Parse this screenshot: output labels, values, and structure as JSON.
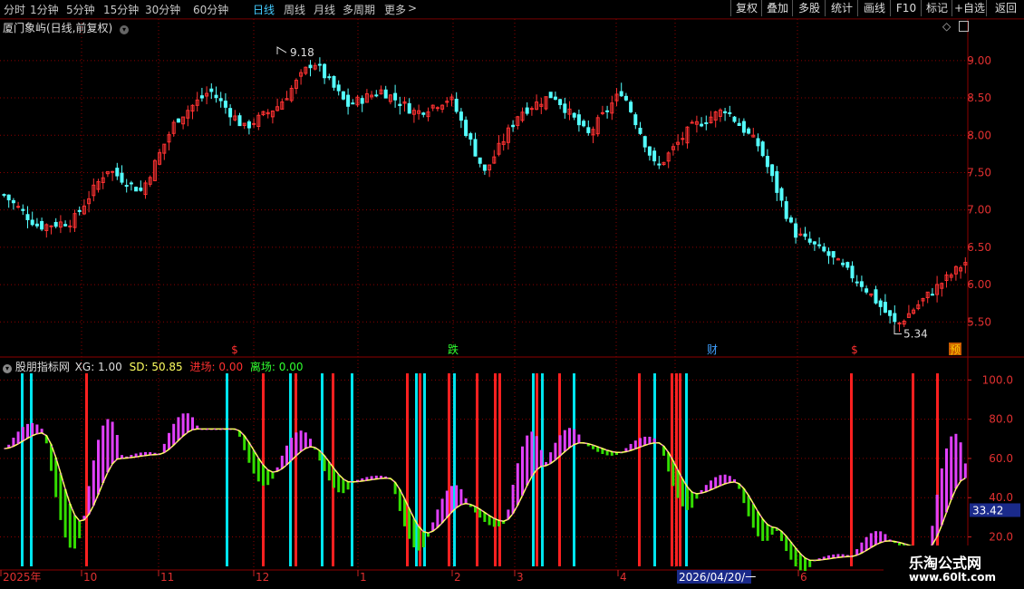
{
  "toolbar": {
    "periods": [
      "分时",
      "1分钟",
      "5分钟",
      "15分钟",
      "30分钟",
      "60分钟",
      "日线",
      "周线",
      "月线",
      "多周期",
      "更多"
    ],
    "active_period": "日线",
    "more_arrow": ">",
    "buttons": [
      "复权",
      "叠加",
      "多股",
      "统计",
      "画线",
      "F10",
      "标记",
      "+自选",
      "返回"
    ]
  },
  "main_panel": {
    "title": "厦门象屿(日线,前复权)",
    "high_marker": "9.18",
    "low_marker": "5.34",
    "event_markers": [
      {
        "text": "$",
        "color": "#ff3030"
      },
      {
        "text": "跌",
        "color": "#30ff30"
      },
      {
        "text": "财",
        "color": "#40a0ff"
      },
      {
        "text": "$",
        "color": "#ff3030"
      },
      {
        "text": "预",
        "color": "#ffcc00"
      }
    ]
  },
  "indicator_panel": {
    "name": "股朋指标网",
    "xg_label": "XG: 1.00",
    "sd_label": "SD: 50.85",
    "entry_label": "进场: 0.00",
    "exit_label": "离场: 0.00",
    "current_value_tag": "33.42"
  },
  "time_axis": {
    "labels": [
      "2025年",
      "10",
      "11",
      "12",
      "1",
      "2",
      "3",
      "4",
      "2026/04/20/一",
      "6"
    ]
  },
  "watermark": {
    "title": "乐淘公式网",
    "url": "www.60lt.com"
  },
  "colors": {
    "up": "#ff3232",
    "down": "#54ffff",
    "grid": "#8b0000",
    "bar_up": "#e040fb",
    "bar_down": "#33dd00",
    "signal_red": "#ff2020",
    "signal_cyan": "#00e5ee",
    "sd_line": "#ffff60"
  },
  "chart_data": [
    {
      "type": "candlestick",
      "title": "厦门象屿(日线,前复权)",
      "ylim": [
        5.2,
        9.35
      ],
      "yticks": [
        5.5,
        6.0,
        6.5,
        7.0,
        7.5,
        8.0,
        8.5,
        9.0
      ],
      "high": 9.18,
      "low": 5.34,
      "close_path": [
        {
          "x": "2025-09",
          "y": 7.2
        },
        {
          "x": "2025-09",
          "y": 6.78
        },
        {
          "x": "2025-10",
          "y": 6.85
        },
        {
          "x": "2025-10",
          "y": 7.55
        },
        {
          "x": "2025-10",
          "y": 7.25
        },
        {
          "x": "2025-11",
          "y": 8.2
        },
        {
          "x": "2025-11",
          "y": 8.6
        },
        {
          "x": "2025-11",
          "y": 8.1
        },
        {
          "x": "2025-12",
          "y": 8.4
        },
        {
          "x": "2025-12",
          "y": 9.0
        },
        {
          "x": "2025-12",
          "y": 8.4
        },
        {
          "x": "2026-01",
          "y": 8.6
        },
        {
          "x": "2026-01",
          "y": 8.3
        },
        {
          "x": "2026-01",
          "y": 8.5
        },
        {
          "x": "2026-02",
          "y": 7.5
        },
        {
          "x": "2026-02",
          "y": 8.3
        },
        {
          "x": "2026-03",
          "y": 8.55
        },
        {
          "x": "2026-03",
          "y": 8.0
        },
        {
          "x": "2026-03",
          "y": 8.6
        },
        {
          "x": "2026-03",
          "y": 7.55
        },
        {
          "x": "2026-04",
          "y": 8.1
        },
        {
          "x": "2026-04",
          "y": 8.35
        },
        {
          "x": "2026-04",
          "y": 7.85
        },
        {
          "x": "2026-05",
          "y": 6.7
        },
        {
          "x": "2026-05",
          "y": 6.4
        },
        {
          "x": "2026-05",
          "y": 6.0
        },
        {
          "x": "2026-06",
          "y": 5.45
        },
        {
          "x": "2026-06",
          "y": 5.9
        },
        {
          "x": "2026-06",
          "y": 6.3
        }
      ]
    },
    {
      "type": "bar",
      "title": "股朋指标网",
      "ylim": [
        5,
        108
      ],
      "yticks": [
        20.0,
        40.0,
        60.0,
        80.0,
        100.0
      ],
      "sd_path": [
        {
          "x": "2025-09",
          "y": 65
        },
        {
          "x": "2025-09",
          "y": 73
        },
        {
          "x": "2025-10",
          "y": 28
        },
        {
          "x": "2025-10",
          "y": 60
        },
        {
          "x": "2025-11",
          "y": 62
        },
        {
          "x": "2025-11",
          "y": 75
        },
        {
          "x": "2025-12",
          "y": 75
        },
        {
          "x": "2025-12",
          "y": 53
        },
        {
          "x": "2025-12",
          "y": 66
        },
        {
          "x": "2026-01",
          "y": 48
        },
        {
          "x": "2026-01",
          "y": 50
        },
        {
          "x": "2026-01",
          "y": 22
        },
        {
          "x": "2026-02",
          "y": 37
        },
        {
          "x": "2026-02",
          "y": 28
        },
        {
          "x": "2026-03",
          "y": 56
        },
        {
          "x": "2026-03",
          "y": 68
        },
        {
          "x": "2026-03",
          "y": 63
        },
        {
          "x": "2026-04",
          "y": 68
        },
        {
          "x": "2026-04",
          "y": 42
        },
        {
          "x": "2026-04",
          "y": 48
        },
        {
          "x": "2026-05",
          "y": 25
        },
        {
          "x": "2026-05",
          "y": 8
        },
        {
          "x": "2026-06",
          "y": 10
        },
        {
          "x": "2026-06",
          "y": 18
        },
        {
          "x": "2026-06",
          "y": 14
        },
        {
          "x": "2026-06",
          "y": 50
        }
      ],
      "current_sd": 50.85,
      "xg": 1.0,
      "entry": 0.0,
      "exit": 0.0
    }
  ]
}
